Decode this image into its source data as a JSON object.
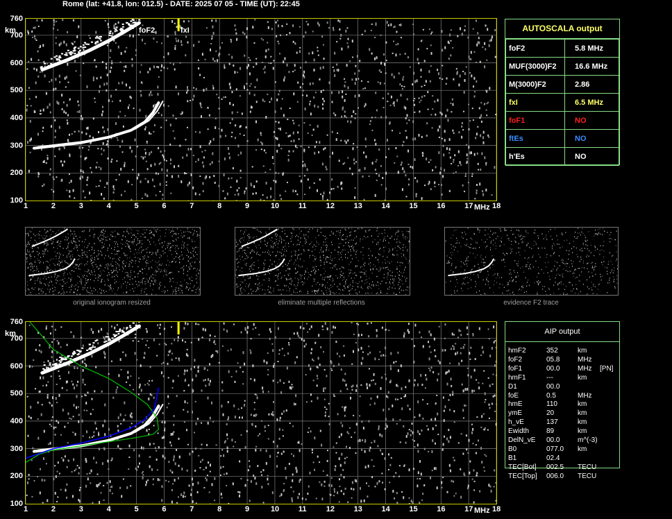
{
  "header": {
    "title": "Rome (lat: +41.8, lon: 012.5) - DATE: 2025 07 05 - TIME (UT): 22:45"
  },
  "axes": {
    "x_ticks": [
      "1",
      "2",
      "3",
      "4",
      "5",
      "6",
      "7",
      "8",
      "9",
      "10",
      "11",
      "12",
      "13",
      "14",
      "15",
      "16",
      "17",
      "18"
    ],
    "y_ticks": [
      "760",
      "700",
      "600",
      "500",
      "400",
      "300",
      "200",
      "100"
    ],
    "x_unit": "MHz",
    "y_unit": "km"
  },
  "markers": {
    "foF2": "foF2",
    "fxI": "fxI"
  },
  "colors": {
    "axis": "#cccc00",
    "grid": "#808080",
    "trace": "#ffffff",
    "profile": "#00c000",
    "fit": "#0000ff"
  },
  "autoscala": {
    "title": "AUTOSCALA output",
    "rows": [
      {
        "label": "foF2",
        "value": "5.8 MHz",
        "color": "#ffffff"
      },
      {
        "label": "MUF(3000)F2",
        "value": "16.6 MHz",
        "color": "#ffffff"
      },
      {
        "label": "M(3000)F2",
        "value": "2.86",
        "color": "#ffffff"
      },
      {
        "label": "fxI",
        "value": "6.5 MHz",
        "color": "#ffff66"
      },
      {
        "label": "foF1",
        "value": "NO",
        "color": "#ff2020"
      },
      {
        "label": "ftEs",
        "value": "NO",
        "color": "#3a8cff"
      },
      {
        "label": "h'Es",
        "value": "NO",
        "color": "#ffffff"
      }
    ]
  },
  "thumbnails": [
    {
      "caption": "original ionogram resized"
    },
    {
      "caption": "eliminate multiple reflections"
    },
    {
      "caption": "evidence F2 trace"
    }
  ],
  "aip": {
    "title": "AIP output",
    "rows": [
      {
        "name": "hmF2",
        "value": "352",
        "unit": "km",
        "extra": ""
      },
      {
        "name": "foF2",
        "value": "05.8",
        "unit": "MHz",
        "extra": ""
      },
      {
        "name": "foF1",
        "value": "00.0",
        "unit": "MHz",
        "extra": "[PN]"
      },
      {
        "name": "hmF1",
        "value": "---",
        "unit": "km",
        "extra": ""
      },
      {
        "name": "D1",
        "value": "00.0",
        "unit": "",
        "extra": ""
      },
      {
        "name": "foE",
        "value": "0.5",
        "unit": "MHz",
        "extra": ""
      },
      {
        "name": "hmE",
        "value": "110",
        "unit": "km",
        "extra": ""
      },
      {
        "name": "ymE",
        "value": "20",
        "unit": "km",
        "extra": ""
      },
      {
        "name": "h_vE",
        "value": "137",
        "unit": "km",
        "extra": ""
      },
      {
        "name": "Ewidth",
        "value": "89",
        "unit": "km",
        "extra": ""
      },
      {
        "name": "DelN_vE",
        "value": "00.0",
        "unit": "m^(-3)",
        "extra": ""
      },
      {
        "name": "B0",
        "value": "077.0",
        "unit": "km",
        "extra": ""
      },
      {
        "name": "B1",
        "value": "02.4",
        "unit": "",
        "extra": ""
      },
      {
        "name": "TEC[Bot]",
        "value": "002.5",
        "unit": "TECU",
        "extra": ""
      },
      {
        "name": "TEC[Top]",
        "value": "006.0",
        "unit": "TECU",
        "extra": ""
      }
    ]
  }
}
